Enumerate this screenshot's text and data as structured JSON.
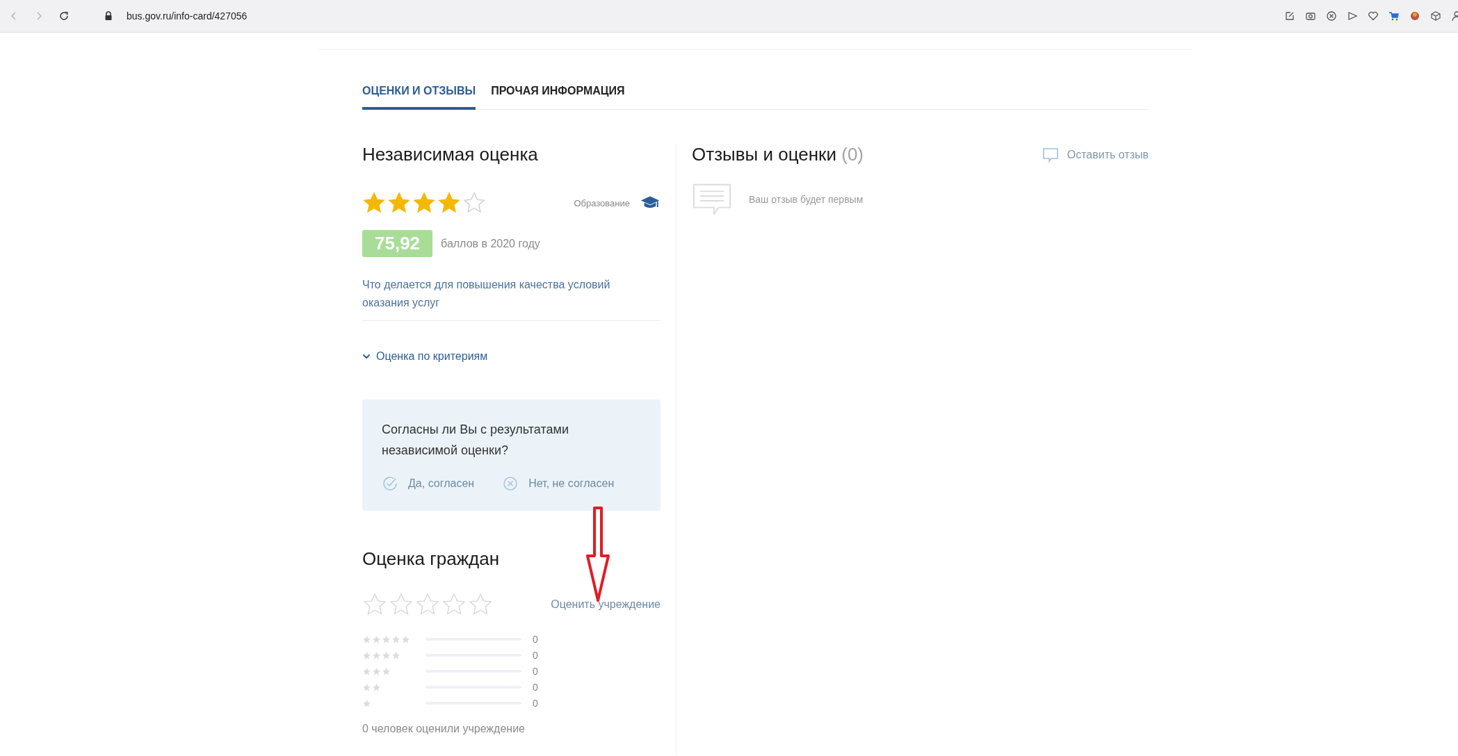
{
  "browser": {
    "url": "bus.gov.ru/info-card/427056"
  },
  "tabs": [
    {
      "label": "ОЦЕНКИ И ОТЗЫВЫ",
      "selected": true
    },
    {
      "label": "ПРОЧАЯ ИНФОРМАЦИЯ",
      "selected": false
    }
  ],
  "independent": {
    "title": "Независимая оценка",
    "stars": 4,
    "category": "Образование",
    "score": "75,92",
    "score_caption": "баллов в 2020 году",
    "improvement_link": "Что делается для повышения качества условий оказания услуг",
    "criteria_toggle": {
      "label": "Оценка по критериям",
      "expanded": false
    }
  },
  "agreement": {
    "question": "Согласны ли Вы с результатами независимой оценки?",
    "options": [
      {
        "kind": "yes",
        "label": "Да, согласен"
      },
      {
        "kind": "no",
        "label": "Нет, не согласен"
      }
    ]
  },
  "citizens": {
    "title": "Оценка граждан",
    "stars": 0,
    "rate_link": "Оценить учреждение",
    "distribution": [
      {
        "count": "0"
      },
      {
        "count": "0"
      },
      {
        "count": "0"
      },
      {
        "count": "0"
      },
      {
        "count": "0"
      }
    ],
    "summary": "0 человек оценили учреждение"
  },
  "reviews": {
    "title": "Отзывы и оценки",
    "count": "(0)",
    "leave_link": "Оставить отзыв",
    "empty_text": "Ваш отзыв будет первым"
  }
}
